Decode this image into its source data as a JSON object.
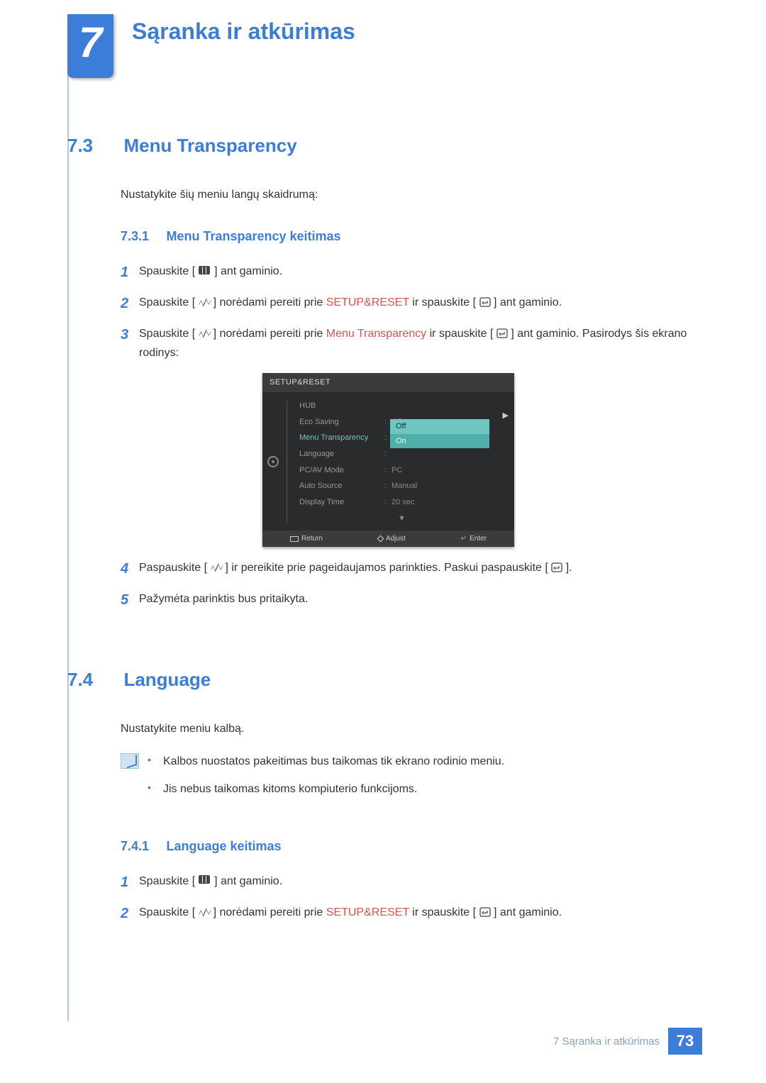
{
  "chapter": {
    "number": "7",
    "title": "Sąranka ir atkūrimas"
  },
  "section73": {
    "number": "7.3",
    "title": "Menu Transparency",
    "intro": "Nustatykite šių meniu langų skaidrumą:",
    "sub": {
      "number": "7.3.1",
      "title": "Menu Transparency keitimas"
    },
    "steps": {
      "s1_a": "Spauskite [",
      "s1_b": "] ant gaminio.",
      "s2_a": "Spauskite [",
      "s2_b": "] norėdami pereiti prie ",
      "s2_hl": "SETUP&RESET",
      "s2_c": " ir spauskite [",
      "s2_d": "] ant gaminio.",
      "s3_a": "Spauskite [",
      "s3_b": "] norėdami pereiti prie ",
      "s3_hl": "Menu Transparency",
      "s3_c": " ir spauskite [",
      "s3_d": "] ant gaminio. Pasirodys šis ekrano rodinys:",
      "s4_a": "Paspauskite [",
      "s4_b": "] ir pereikite prie pageidaujamos parinkties. Paskui paspauskite [",
      "s4_c": "].",
      "s5": "Pažymėta parinktis bus pritaikyta."
    }
  },
  "osd": {
    "title": "SETUP&RESET",
    "rows": [
      {
        "label": "HUB",
        "value": ""
      },
      {
        "label": "Eco Saving",
        "value": "Off"
      },
      {
        "label": "Menu Transparency",
        "value": "Off",
        "selected": true
      },
      {
        "label": "Language",
        "value": ""
      },
      {
        "label": "PC/AV Mode",
        "value": "PC"
      },
      {
        "label": "Auto Source",
        "value": "Manual"
      },
      {
        "label": "Display Time",
        "value": "20 sec"
      }
    ],
    "popup": {
      "off": "Off",
      "on": "On"
    },
    "footer": {
      "return": "Return",
      "adjust": "Adjust",
      "enter": "Enter"
    }
  },
  "section74": {
    "number": "7.4",
    "title": "Language",
    "intro": "Nustatykite meniu kalbą.",
    "notes": [
      "Kalbos nuostatos pakeitimas bus taikomas tik ekrano rodinio meniu.",
      "Jis nebus taikomas kitoms kompiuterio funkcijoms."
    ],
    "sub": {
      "number": "7.4.1",
      "title": "Language keitimas"
    },
    "steps": {
      "s1_a": "Spauskite [",
      "s1_b": "] ant gaminio.",
      "s2_a": "Spauskite [",
      "s2_b": "] norėdami pereiti prie ",
      "s2_hl": "SETUP&RESET",
      "s2_c": " ir spauskite [",
      "s2_d": "] ant gaminio."
    }
  },
  "footer": {
    "text": "7 Sąranka ir atkūrimas",
    "page": "73"
  }
}
